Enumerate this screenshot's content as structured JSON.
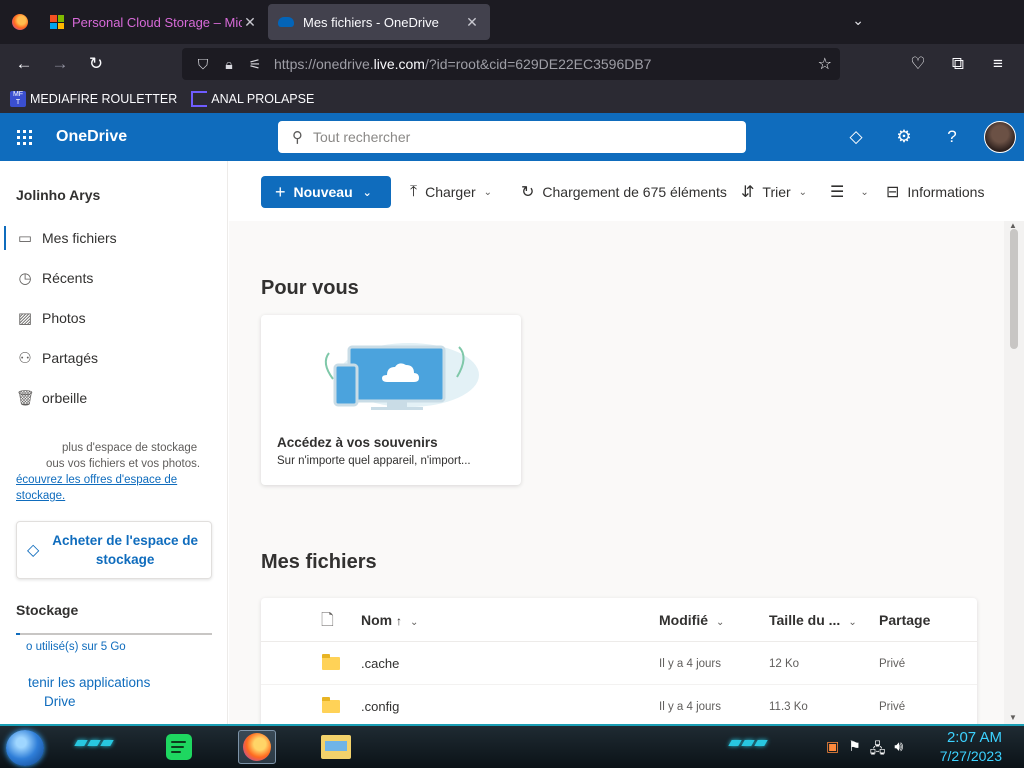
{
  "browser": {
    "tabs": [
      {
        "title": "Personal Cloud Storage – Microsoft",
        "icon": "microsoft-logo-icon",
        "active": false
      },
      {
        "title": "Mes fichiers - OneDrive",
        "icon": "onedrive-icon",
        "active": true
      }
    ],
    "url_prefix": "https://onedrive.",
    "url_domain": "live.com",
    "url_suffix": "/?id=root&cid=629DE22EC3596DB7",
    "bookmarks": [
      {
        "label": "MEDIAFIRE ROULETTER",
        "icon": "mediafire-icon"
      },
      {
        "label": "ANAL PROLAPSE",
        "icon": "bookmark-sigma-icon"
      }
    ]
  },
  "header": {
    "app_name": "OneDrive",
    "search_placeholder": "Tout rechercher",
    "accent": "#0f6cbd"
  },
  "sidebar": {
    "user_name": "Jolinho Arys",
    "items": [
      {
        "label": "Mes fichiers",
        "icon": "folder-icon",
        "selected": true
      },
      {
        "label": "Récents",
        "icon": "history-icon",
        "selected": false
      },
      {
        "label": "Photos",
        "icon": "photo-icon",
        "selected": false
      },
      {
        "label": "Partagés",
        "icon": "people-icon",
        "selected": false
      },
      {
        "label": "orbeille",
        "icon": "trash-icon",
        "selected": false
      }
    ],
    "promo_line1": "plus d'espace de stockage",
    "promo_line2": "ous vos fichiers et vos photos.",
    "promo_link": "écouvrez les offres d'espace de stockage.",
    "buy_button": "Acheter de l'espace de stockage",
    "storage_title": "Stockage",
    "storage_used_fraction": 0.01,
    "storage_text": "o utilisé(s) sur 5 Go",
    "get_apps_line1": "tenir les applications",
    "get_apps_line2": "Drive"
  },
  "commands": {
    "new": "Nouveau",
    "upload": "Charger",
    "sync": "Chargement de 675 éléments",
    "sort": "Trier",
    "info": "Informations"
  },
  "for_you": {
    "title": "Pour vous",
    "card_title": "Accédez à vos souvenirs",
    "card_sub": "Sur n'importe quel appareil, n'import..."
  },
  "my_files": {
    "title": "Mes fichiers",
    "columns": {
      "name": "Nom",
      "modified": "Modifié",
      "size": "Taille du ...",
      "sharing": "Partage"
    },
    "rows": [
      {
        "name": ".cache",
        "modified": "Il y a 4 jours",
        "size": "12 Ko",
        "sharing": "Privé"
      },
      {
        "name": ".config",
        "modified": "Il y a 4 jours",
        "size": "11.3 Ko",
        "sharing": "Privé"
      }
    ]
  },
  "taskbar": {
    "time": "2:07 AM",
    "date": "7/27/2023"
  }
}
